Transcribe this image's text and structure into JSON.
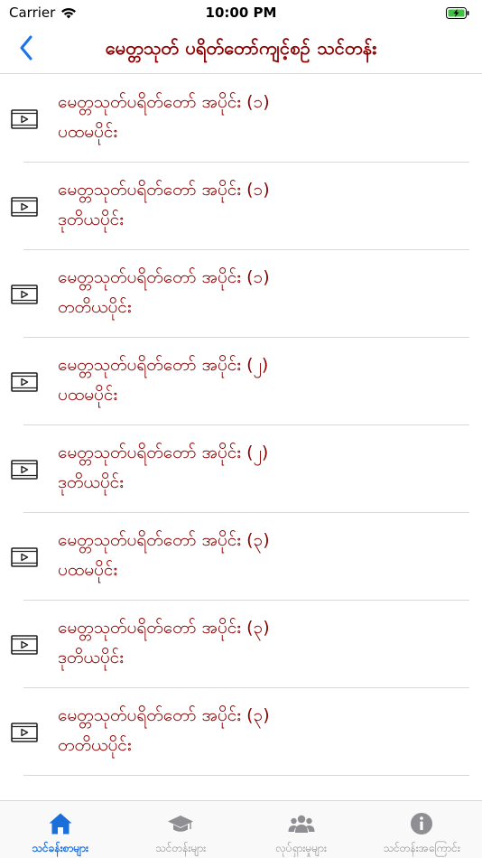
{
  "status_bar": {
    "carrier": "Carrier",
    "time": "10:00 PM"
  },
  "nav": {
    "title": "မေတ္တသုတ် ပရိတ်တော်ကျင့်စဉ် သင်တန်း"
  },
  "lessons": [
    {
      "title": "မေတ္တသုတ်ပရိတ်တော် အပိုင်း (၁)",
      "subtitle": "ပထမပိုင်း",
      "icon": "video-icon"
    },
    {
      "title": "မေတ္တသုတ်ပရိတ်တော် အပိုင်း (၁)",
      "subtitle": "ဒုတိယပိုင်း",
      "icon": "video-icon"
    },
    {
      "title": "မေတ္တသုတ်ပရိတ်တော် အပိုင်း (၁)",
      "subtitle": "တတိယပိုင်း",
      "icon": "video-icon"
    },
    {
      "title": "မေတ္တသုတ်ပရိတ်တော် အပိုင်း (၂)",
      "subtitle": "ပထမပိုင်း",
      "icon": "video-icon"
    },
    {
      "title": "မေတ္တသုတ်ပရိတ်တော် အပိုင်း (၂)",
      "subtitle": "ဒုတိယပိုင်း",
      "icon": "video-icon"
    },
    {
      "title": "မေတ္တသုတ်ပရိတ်တော် အပိုင်း (၃)",
      "subtitle": "ပထမပိုင်း",
      "icon": "video-icon"
    },
    {
      "title": "မေတ္တသုတ်ပရိတ်တော် အပိုင်း (၃)",
      "subtitle": "ဒုတိယပိုင်း",
      "icon": "video-icon"
    },
    {
      "title": "မေတ္တသုတ်ပရိတ်တော် အပိုင်း (၃)",
      "subtitle": "တတိယပိုင်း",
      "icon": "video-icon"
    }
  ],
  "tabs": [
    {
      "label": "သင်ခန်းစာများ",
      "icon": "home-icon",
      "active": true
    },
    {
      "label": "သင်တန်းများ",
      "icon": "graduation-cap-icon",
      "active": false
    },
    {
      "label": "လုပ်ရှားမှုများ",
      "icon": "group-icon",
      "active": false
    },
    {
      "label": "သင်တန်းအကြောင်း",
      "icon": "info-icon",
      "active": false
    }
  ],
  "colors": {
    "accent_text": "#8b0000",
    "tab_active": "#1a6fd8",
    "tab_inactive": "#8e8e93",
    "back_arrow": "#1a73e8"
  }
}
